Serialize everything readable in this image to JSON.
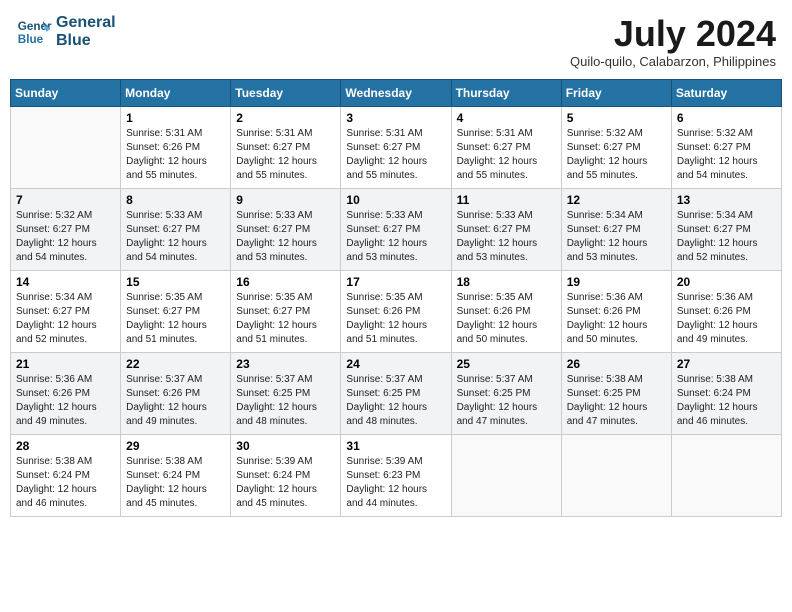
{
  "header": {
    "logo_line1": "General",
    "logo_line2": "Blue",
    "title": "July 2024",
    "location": "Quilo-quilo, Calabarzon, Philippines"
  },
  "days_of_week": [
    "Sunday",
    "Monday",
    "Tuesday",
    "Wednesday",
    "Thursday",
    "Friday",
    "Saturday"
  ],
  "weeks": [
    [
      {
        "day": "",
        "info": ""
      },
      {
        "day": "1",
        "info": "Sunrise: 5:31 AM\nSunset: 6:26 PM\nDaylight: 12 hours\nand 55 minutes."
      },
      {
        "day": "2",
        "info": "Sunrise: 5:31 AM\nSunset: 6:27 PM\nDaylight: 12 hours\nand 55 minutes."
      },
      {
        "day": "3",
        "info": "Sunrise: 5:31 AM\nSunset: 6:27 PM\nDaylight: 12 hours\nand 55 minutes."
      },
      {
        "day": "4",
        "info": "Sunrise: 5:31 AM\nSunset: 6:27 PM\nDaylight: 12 hours\nand 55 minutes."
      },
      {
        "day": "5",
        "info": "Sunrise: 5:32 AM\nSunset: 6:27 PM\nDaylight: 12 hours\nand 55 minutes."
      },
      {
        "day": "6",
        "info": "Sunrise: 5:32 AM\nSunset: 6:27 PM\nDaylight: 12 hours\nand 54 minutes."
      }
    ],
    [
      {
        "day": "7",
        "info": "Sunrise: 5:32 AM\nSunset: 6:27 PM\nDaylight: 12 hours\nand 54 minutes."
      },
      {
        "day": "8",
        "info": "Sunrise: 5:33 AM\nSunset: 6:27 PM\nDaylight: 12 hours\nand 54 minutes."
      },
      {
        "day": "9",
        "info": "Sunrise: 5:33 AM\nSunset: 6:27 PM\nDaylight: 12 hours\nand 53 minutes."
      },
      {
        "day": "10",
        "info": "Sunrise: 5:33 AM\nSunset: 6:27 PM\nDaylight: 12 hours\nand 53 minutes."
      },
      {
        "day": "11",
        "info": "Sunrise: 5:33 AM\nSunset: 6:27 PM\nDaylight: 12 hours\nand 53 minutes."
      },
      {
        "day": "12",
        "info": "Sunrise: 5:34 AM\nSunset: 6:27 PM\nDaylight: 12 hours\nand 53 minutes."
      },
      {
        "day": "13",
        "info": "Sunrise: 5:34 AM\nSunset: 6:27 PM\nDaylight: 12 hours\nand 52 minutes."
      }
    ],
    [
      {
        "day": "14",
        "info": "Sunrise: 5:34 AM\nSunset: 6:27 PM\nDaylight: 12 hours\nand 52 minutes."
      },
      {
        "day": "15",
        "info": "Sunrise: 5:35 AM\nSunset: 6:27 PM\nDaylight: 12 hours\nand 51 minutes."
      },
      {
        "day": "16",
        "info": "Sunrise: 5:35 AM\nSunset: 6:27 PM\nDaylight: 12 hours\nand 51 minutes."
      },
      {
        "day": "17",
        "info": "Sunrise: 5:35 AM\nSunset: 6:26 PM\nDaylight: 12 hours\nand 51 minutes."
      },
      {
        "day": "18",
        "info": "Sunrise: 5:35 AM\nSunset: 6:26 PM\nDaylight: 12 hours\nand 50 minutes."
      },
      {
        "day": "19",
        "info": "Sunrise: 5:36 AM\nSunset: 6:26 PM\nDaylight: 12 hours\nand 50 minutes."
      },
      {
        "day": "20",
        "info": "Sunrise: 5:36 AM\nSunset: 6:26 PM\nDaylight: 12 hours\nand 49 minutes."
      }
    ],
    [
      {
        "day": "21",
        "info": "Sunrise: 5:36 AM\nSunset: 6:26 PM\nDaylight: 12 hours\nand 49 minutes."
      },
      {
        "day": "22",
        "info": "Sunrise: 5:37 AM\nSunset: 6:26 PM\nDaylight: 12 hours\nand 49 minutes."
      },
      {
        "day": "23",
        "info": "Sunrise: 5:37 AM\nSunset: 6:25 PM\nDaylight: 12 hours\nand 48 minutes."
      },
      {
        "day": "24",
        "info": "Sunrise: 5:37 AM\nSunset: 6:25 PM\nDaylight: 12 hours\nand 48 minutes."
      },
      {
        "day": "25",
        "info": "Sunrise: 5:37 AM\nSunset: 6:25 PM\nDaylight: 12 hours\nand 47 minutes."
      },
      {
        "day": "26",
        "info": "Sunrise: 5:38 AM\nSunset: 6:25 PM\nDaylight: 12 hours\nand 47 minutes."
      },
      {
        "day": "27",
        "info": "Sunrise: 5:38 AM\nSunset: 6:24 PM\nDaylight: 12 hours\nand 46 minutes."
      }
    ],
    [
      {
        "day": "28",
        "info": "Sunrise: 5:38 AM\nSunset: 6:24 PM\nDaylight: 12 hours\nand 46 minutes."
      },
      {
        "day": "29",
        "info": "Sunrise: 5:38 AM\nSunset: 6:24 PM\nDaylight: 12 hours\nand 45 minutes."
      },
      {
        "day": "30",
        "info": "Sunrise: 5:39 AM\nSunset: 6:24 PM\nDaylight: 12 hours\nand 45 minutes."
      },
      {
        "day": "31",
        "info": "Sunrise: 5:39 AM\nSunset: 6:23 PM\nDaylight: 12 hours\nand 44 minutes."
      },
      {
        "day": "",
        "info": ""
      },
      {
        "day": "",
        "info": ""
      },
      {
        "day": "",
        "info": ""
      }
    ]
  ]
}
